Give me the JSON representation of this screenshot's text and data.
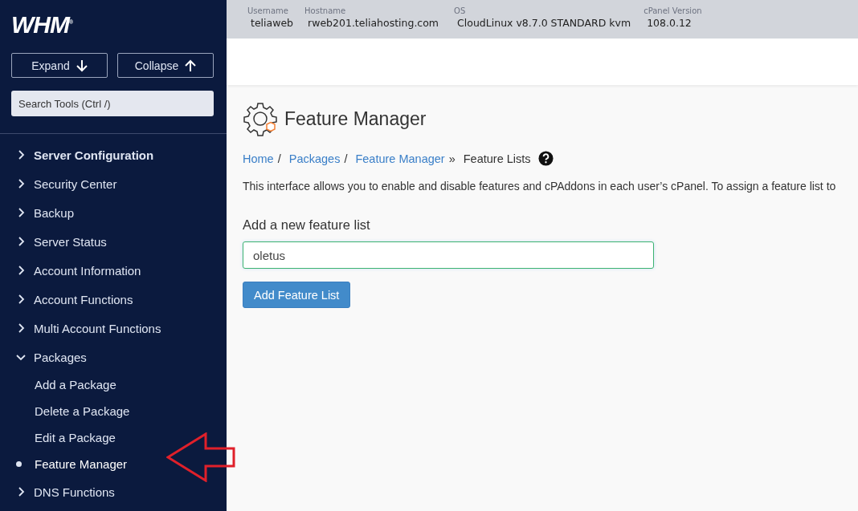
{
  "sidebar": {
    "logo": "WHM$^{®}$",
    "expand_button": "Expand",
    "collapse_button": "Collapse",
    "search": {
      "placeholder": "Search Tools (Ctrl /)"
    },
    "items": [
      {
        "label": "Server Configuration",
        "expanded": false
      },
      {
        "label": "Security Center",
        "expanded": false
      },
      {
        "label": "Backup",
        "expanded": false
      },
      {
        "label": "Server Status",
        "expanded": false
      },
      {
        "label": "Account Information",
        "expanded": false
      },
      {
        "label": "Account Functions",
        "expanded": false
      },
      {
        "label": "Multi Account Functions",
        "expanded": false
      },
      {
        "label": "Packages",
        "expanded": true,
        "children": [
          {
            "label": "Add a Package",
            "selected": false
          },
          {
            "label": "Delete a Package",
            "selected": false
          },
          {
            "label": "Edit a Package",
            "selected": false
          },
          {
            "label": "Feature Manager",
            "selected": true
          }
        ]
      },
      {
        "label": "DNS Functions",
        "expanded": false
      }
    ]
  },
  "header": {
    "fields": [
      {
        "label": "Username",
        "value": "teliaweb"
      },
      {
        "label": "Hostname",
        "value": "rweb201.teliahosting.com"
      },
      {
        "label": "OS",
        "value": "CloudLinux v8.7.0 STANDARD kvm"
      },
      {
        "label": "cPanel Version",
        "value": "108.0.12"
      }
    ]
  },
  "page": {
    "title": "Feature Manager",
    "breadcrumb": [
      {
        "label": "Home",
        "kind": "link",
        "sep": "/"
      },
      {
        "label": "Packages",
        "kind": "link",
        "sep": "/"
      },
      {
        "label": "Feature Manager",
        "kind": "link",
        "sep": "»"
      },
      {
        "label": "Feature Lists",
        "kind": "current"
      }
    ],
    "description": "This interface allows you to enable and disable features and cPAddons in each user’s cPanel. To assign a feature list to",
    "form": {
      "label": "Add a new feature list",
      "value": "oletus",
      "button": "Add Feature List"
    }
  }
}
